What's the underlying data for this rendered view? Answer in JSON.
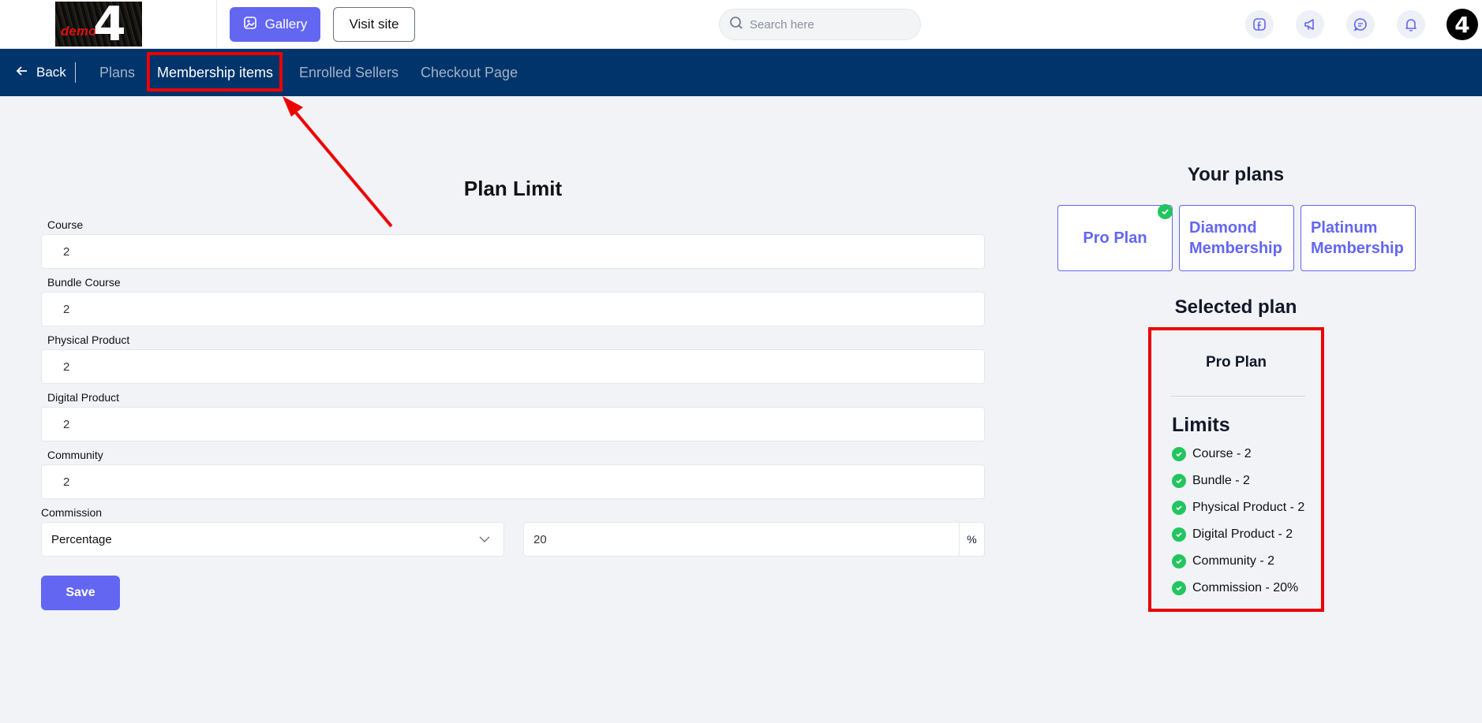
{
  "header": {
    "logo_text": "demo",
    "logo_number": "4",
    "gallery_label": "Gallery",
    "visit_site_label": "Visit site",
    "search_placeholder": "Search here",
    "avatar_text": "4"
  },
  "nav": {
    "back_label": "Back",
    "tabs": [
      {
        "label": "Plans"
      },
      {
        "label": "Membership items"
      },
      {
        "label": "Enrolled Sellers"
      },
      {
        "label": "Checkout Page"
      }
    ]
  },
  "form": {
    "title": "Plan Limit",
    "fields": [
      {
        "label": "Course",
        "value": "2"
      },
      {
        "label": "Bundle Course",
        "value": "2"
      },
      {
        "label": "Physical Product",
        "value": "2"
      },
      {
        "label": "Digital Product",
        "value": "2"
      },
      {
        "label": "Community",
        "value": "2"
      }
    ],
    "commission_label": "Commission",
    "commission_type": "Percentage",
    "commission_value": "20",
    "commission_unit": "%",
    "save_label": "Save"
  },
  "plans": {
    "title": "Your plans",
    "items": [
      {
        "label": "Pro Plan",
        "selected": true
      },
      {
        "label": "Diamond Membership",
        "selected": false
      },
      {
        "label": "Platinum Membership",
        "selected": false
      }
    ]
  },
  "selected": {
    "title": "Selected plan",
    "name": "Pro Plan",
    "limits_title": "Limits",
    "limits": [
      "Course - 2",
      "Bundle - 2",
      "Physical Product - 2",
      "Digital Product - 2",
      "Community - 2",
      "Commission - 20%"
    ]
  },
  "colors": {
    "accent": "#6366f1",
    "navbar": "#00346a",
    "success": "#22c55e",
    "annotation": "#ee0000"
  }
}
